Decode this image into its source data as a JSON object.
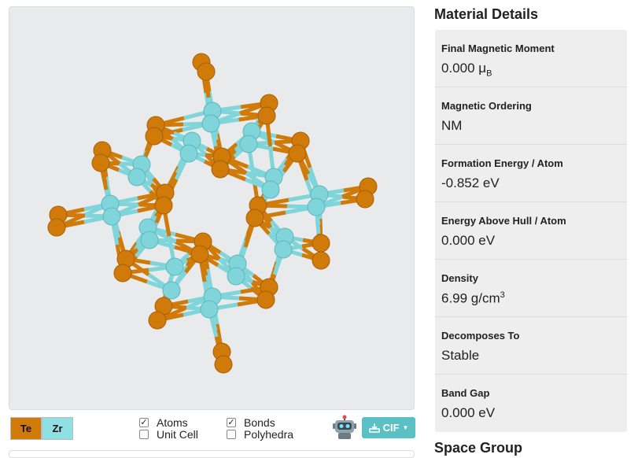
{
  "viewer": {
    "element_colors": {
      "Te": "#d07a0a",
      "Zr": "#7fd5d9"
    }
  },
  "controls": {
    "elements": [
      {
        "label": "Te",
        "color": "#d07a0a"
      },
      {
        "label": "Zr",
        "color": "#8fe0e3"
      }
    ],
    "atoms_label": "Atoms",
    "atoms_checked": true,
    "unit_cell_label": "Unit Cell",
    "unit_cell_checked": false,
    "bonds_label": "Bonds",
    "bonds_checked": true,
    "polyhedra_label": "Polyhedra",
    "polyhedra_checked": false,
    "robot_icon": "robot-icon",
    "download_label": "CIF"
  },
  "details": {
    "title": "Material Details",
    "magnetic_moment_label": "Final Magnetic Moment",
    "magnetic_moment_value": "0.000",
    "magnetic_moment_unit": "μ",
    "magnetic_moment_unit_sub": "B",
    "magnetic_ordering_label": "Magnetic Ordering",
    "magnetic_ordering_value": "NM",
    "formation_energy_label": "Formation Energy / Atom",
    "formation_energy_value": "-0.852 eV",
    "energy_above_hull_label": "Energy Above Hull / Atom",
    "energy_above_hull_value": "0.000 eV",
    "density_label": "Density",
    "density_value": "6.99 g/cm",
    "density_sup": "3",
    "decomposes_label": "Decomposes To",
    "decomposes_value": "Stable",
    "band_gap_label": "Band Gap",
    "band_gap_value": "0.000 eV"
  },
  "space_group": {
    "title": "Space Group"
  }
}
